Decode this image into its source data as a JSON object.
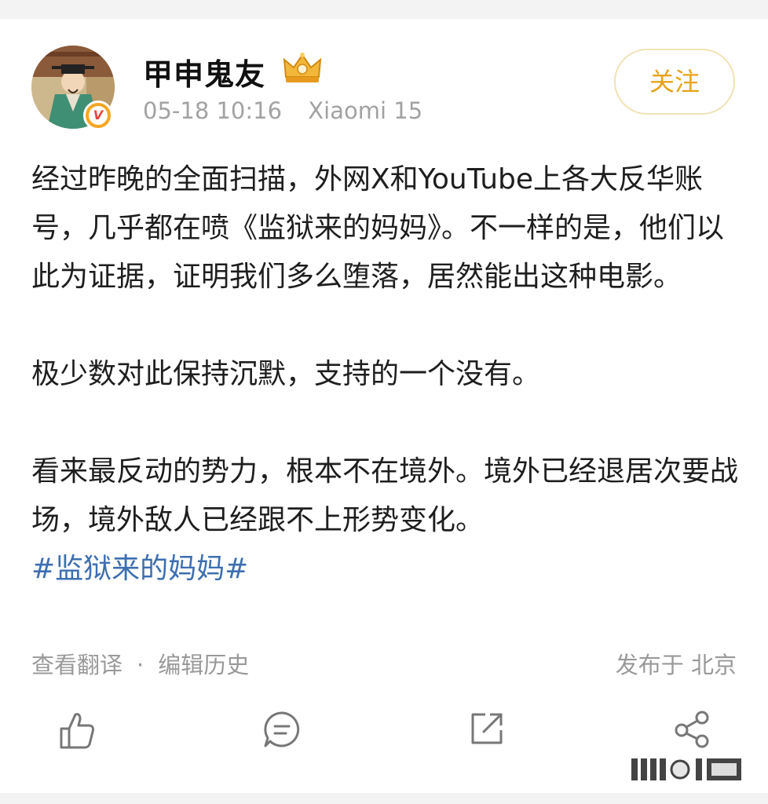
{
  "post": {
    "username": "甲申鬼友",
    "time": "05-18 10:16",
    "device": "Xiaomi 15",
    "follow_label": "关注",
    "verified_mark": "V",
    "paragraphs": [
      "经过昨晚的全面扫描，外网X和YouTube上各大反华账号，几乎都在喷《监狱来的妈妈》。不一样的是，他们以此为证据，证明我们多么堕落，居然能出这种电影。",
      "极少数对此保持沉默，支持的一个没有。",
      "看来最反动的势力，根本不在境外。境外已经退居次要战场，境外敌人已经跟不上形势变化。"
    ],
    "hashtag": "#监狱来的妈妈#",
    "translate_label": "查看翻译",
    "separator": "·",
    "edit_history_label": "编辑历史",
    "location_label": "发布于 北京"
  },
  "icons": {
    "like": "thumbs-up-icon",
    "comment": "comment-bubble-icon",
    "repost": "share-arrow-icon",
    "share": "network-share-icon"
  },
  "colors": {
    "accent": "#e8a21a",
    "hashtag": "#3d6fb0",
    "muted": "#a2a2a2"
  }
}
